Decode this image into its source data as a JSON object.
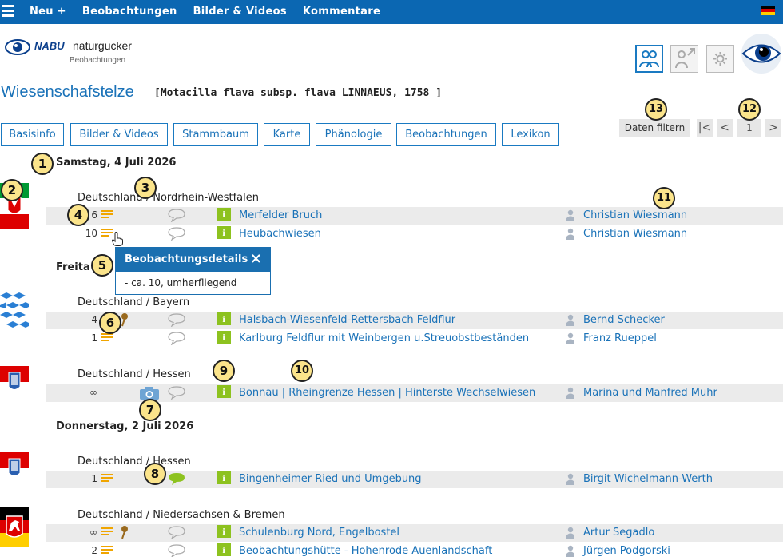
{
  "topnav": {
    "items": [
      "Neu +",
      "Beobachtungen",
      "Bilder & Videos",
      "Kommentare"
    ],
    "flag_colors": [
      "#000000",
      "#dd0000",
      "#ffce00"
    ]
  },
  "header": {
    "logo_nabu": "NABU",
    "logo_name": "naturgucker",
    "logo_sub": "Beobachtungen",
    "icons": [
      "people-icon",
      "person-arrow-icon",
      "gear-icon"
    ]
  },
  "title": {
    "name": "Wiesenschafstelze",
    "scientific": "[Motacilla flava subsp. flava LINNAEUS, 1758 ]"
  },
  "tabs": [
    "Basisinfo",
    "Bilder & Videos",
    "Stammbaum",
    "Karte",
    "Phänologie",
    "Beobachtungen",
    "Lexikon"
  ],
  "filter": {
    "label": "Daten filtern"
  },
  "pagination": {
    "first": "|<",
    "prev": "<",
    "page": "1",
    "next": ">"
  },
  "days": [
    {
      "date": "Samstag, 4 Juli 2026",
      "groups": [
        {
          "region": "Deutschland / Nordrhein-Westfalen",
          "rows": [
            {
              "count": "6",
              "location": "Merfelder Bruch",
              "observer": "Christian Wiesmann"
            },
            {
              "count": "10",
              "location": "Heubachwiesen",
              "observer": "Christian Wiesmann"
            }
          ]
        }
      ]
    },
    {
      "date": "Freita",
      "groups": [
        {
          "region": "Deutschland / Bayern",
          "rows": [
            {
              "count": "4",
              "location": "Halsbach-Wiesenfeld-Rettersbach Feldflur",
              "observer": "Bernd Schecker"
            },
            {
              "count": "1",
              "location": "Karlburg Feldflur mit Weinbergen u.Streuobstbeständen",
              "observer": "Franz Rueppel"
            }
          ]
        },
        {
          "region": "Deutschland / Hessen",
          "rows": [
            {
              "count": "∞",
              "location": "Bonnau | Rheingrenze Hessen | Hinterste Wechselwiesen",
              "observer": "Marina und Manfred Muhr"
            }
          ]
        }
      ]
    },
    {
      "date": "Donnerstag, 2 Juli 2026",
      "groups": [
        {
          "region": "Deutschland / Hessen",
          "rows": [
            {
              "count": "1",
              "location": "Bingenheimer Ried und Umgebung",
              "observer": "Birgit Wichelmann-Werth"
            }
          ]
        },
        {
          "region": "Deutschland / Niedersachsen & Bremen",
          "rows": [
            {
              "count": "∞",
              "location": "Schulenburg Nord, Engelbostel",
              "observer": "Artur Segadlo"
            },
            {
              "count": "2",
              "location": "Beobachtungshütte - Hohenrode Auenlandschaft",
              "observer": "Jürgen Podgorski"
            }
          ]
        }
      ]
    }
  ],
  "info_label": "i",
  "popup": {
    "title": "Beobachtungsdetails",
    "close": "×",
    "text": "-  ca. 10, umherfliegend"
  },
  "callouts": [
    "1",
    "2",
    "3",
    "4",
    "5",
    "6",
    "7",
    "8",
    "9",
    "10",
    "11",
    "12",
    "13"
  ],
  "colors": {
    "accent": "#1a72b8",
    "topbar": "#0b67b2",
    "info_green": "#8dc21f",
    "note_orange": "#f0a500",
    "callout": "#fbe48b"
  }
}
